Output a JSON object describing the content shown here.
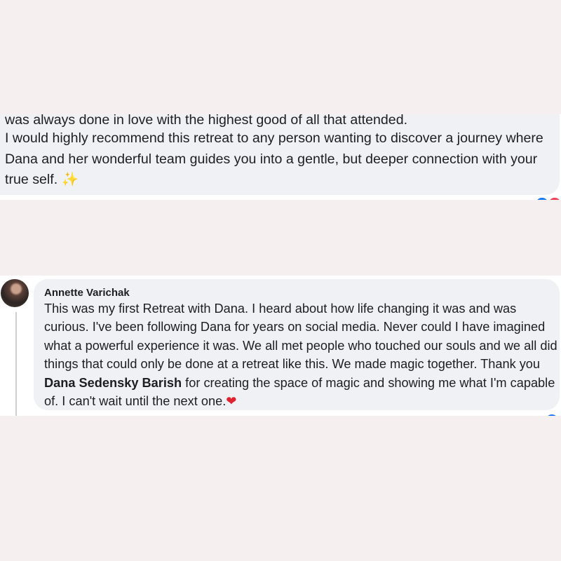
{
  "comment1": {
    "cut_line": "was always done in love with the highest good of all that attended.",
    "body": "I would highly recommend this retreat to any person wanting to discover a journey where Dana and her wonderful team guides you into a gentle, but deeper connection with your true self.",
    "emoji": "✨"
  },
  "comment2": {
    "author": "Annette Varichak",
    "body_part1": "This was my first Retreat with Dana. I heard about how life changing it was and was curious. I've been following Dana for years on social media. Never could I have imagined what a powerful experience it was. We all met people who touched our souls and we all did things that could only be done at a retreat like this. We made magic together. Thank you ",
    "mention": "Dana Sedensky Barish",
    "body_part2": " for creating the space of magic and showing me what I'm capable of. I can't wait until the next one.",
    "emoji": "❤"
  },
  "reactions": {
    "like_color": "#1877f2",
    "love_color": "#f33e58",
    "icons": [
      "like-icon",
      "love-icon"
    ]
  },
  "colors": {
    "page_background": "#f5f0ef",
    "bubble_background": "#eff1f4",
    "text": "#1c1e21"
  }
}
